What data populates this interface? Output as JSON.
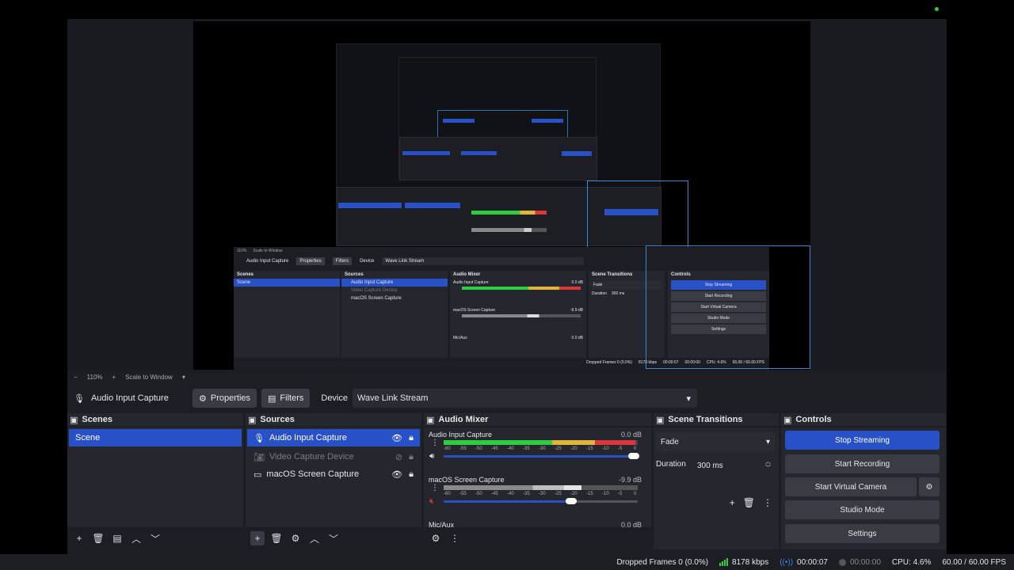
{
  "preview": {
    "inner": {
      "zoom": "110%",
      "scale_mode": "Scale to Window",
      "source_name": "Audio Input Capture",
      "properties_label": "Properties",
      "filters_label": "Filters",
      "device_label": "Device",
      "device_value": "Wave Link Stream",
      "scenes_title": "Scenes",
      "scene_item": "Scene",
      "sources_title": "Sources",
      "sources": [
        "Audio Input Capture",
        "Video Capture Device",
        "macOS Screen Capture"
      ],
      "mixer_title": "Audio Mixer",
      "ch1": "Audio Input Capture",
      "ch1_db": "0.0 dB",
      "ch2": "macOS Screen Capture",
      "ch2_db": "-9.9 dB",
      "ch3": "Mic/Aux",
      "ch3_db": "0.0 dB",
      "transitions_title": "Scene Transitions",
      "fade": "Fade",
      "duration_label": "Duration",
      "duration_value": "300 ms",
      "controls_title": "Controls",
      "controls": [
        "Stop Streaming",
        "Start Recording",
        "Start Virtual Camera",
        "Studio Mode",
        "Settings"
      ],
      "status": {
        "dropped": "Dropped Frames 0 (0.0%)",
        "kbps": "8178 kbps",
        "stream_time": "00:00:07",
        "rec_time": "00:00:00",
        "cpu": "CPU: 4.6%",
        "fps": "60.00 / 60.00 FPS"
      }
    }
  },
  "zoombar": {
    "minus": "−",
    "zoom": "110%",
    "plus": "+",
    "scale_mode": "Scale to Window"
  },
  "context": {
    "source_name": "Audio Input Capture",
    "properties": "Properties",
    "filters": "Filters",
    "device_label": "Device",
    "device_value": "Wave Link Stream"
  },
  "scenes": {
    "title": "Scenes",
    "items": [
      "Scene"
    ]
  },
  "sources": {
    "title": "Sources",
    "items": [
      {
        "label": "Audio Input Capture",
        "icon": "microphone-icon",
        "visible": true,
        "selected": true
      },
      {
        "label": "Video Capture Device",
        "icon": "camera-icon",
        "visible": false,
        "selected": false
      },
      {
        "label": "macOS Screen Capture",
        "icon": "monitor-icon",
        "visible": true,
        "selected": false
      }
    ]
  },
  "mixer": {
    "title": "Audio Mixer",
    "channels": [
      {
        "name": "Audio Input Capture",
        "db": "0.0 dB",
        "level": 0.98
      },
      {
        "name": "macOS Screen Capture",
        "db": "-9.9 dB",
        "level": 0.65
      },
      {
        "name": "Mic/Aux",
        "db": "0.0 dB"
      }
    ],
    "scale": [
      "-60",
      "-55",
      "-50",
      "-45",
      "-40",
      "-35",
      "-30",
      "-25",
      "-20",
      "-15",
      "-10",
      "-5",
      "0"
    ]
  },
  "transitions": {
    "title": "Scene Transitions",
    "type": "Fade",
    "duration_label": "Duration",
    "duration_value": "300 ms"
  },
  "controls": {
    "title": "Controls",
    "stop_streaming": "Stop Streaming",
    "start_recording": "Start Recording",
    "start_virtual_camera": "Start Virtual Camera",
    "studio_mode": "Studio Mode",
    "settings": "Settings"
  },
  "status": {
    "dropped": "Dropped Frames 0 (0.0%)",
    "kbps": "8178 kbps",
    "stream_time": "00:00:07",
    "rec_time": "00:00:00",
    "cpu": "CPU: 4.6%",
    "fps": "60.00 / 60.00 FPS"
  },
  "colors": {
    "accent": "#2951c7",
    "live": "#2ecc40"
  }
}
